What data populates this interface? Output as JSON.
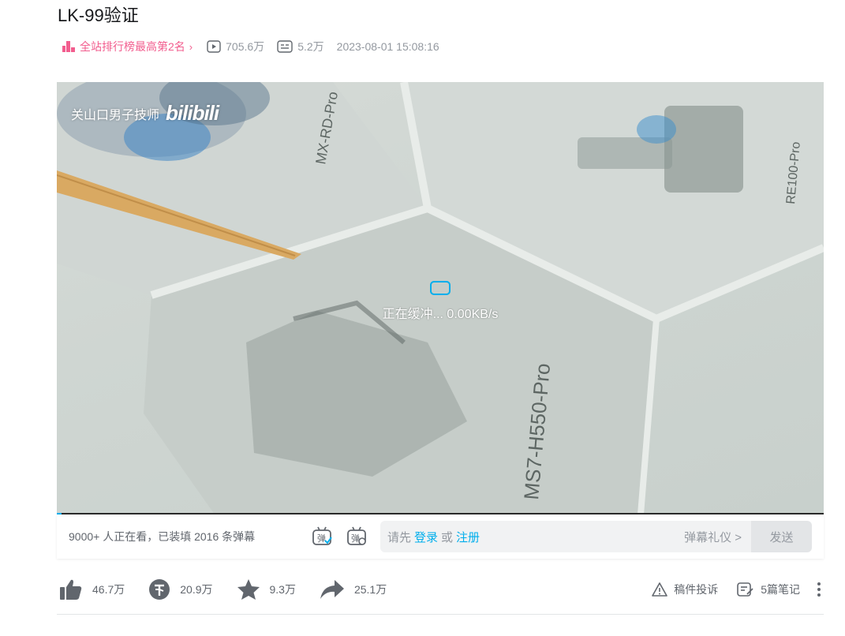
{
  "video": {
    "title": "LK-99验证",
    "rank_label": "全站排行榜最高第2名",
    "plays": "705.6万",
    "danmaku_count": "5.2万",
    "publish_time": "2023-08-01 15:08:16"
  },
  "player": {
    "watermark_author": "关山口男子技师",
    "watermark_logo": "bilibili",
    "buffer_text": "正在缓冲... 0.00KB/s",
    "scene_labels": [
      "MX-RD-Pro",
      "RE100-Pro",
      "MS7-H550-Pro"
    ],
    "progress_fraction": 0.006
  },
  "danmu_bar": {
    "viewers_text": "9000+ 人正在看，已装填 2016 条弹幕",
    "input_prefix": "请先",
    "login_link": "登录",
    "or_text": "或",
    "register_link": "注册",
    "etiquette": "弹幕礼仪 >",
    "send_label": "发送"
  },
  "toolbar": {
    "like": "46.7万",
    "coin": "20.9万",
    "favorite": "9.3万",
    "share": "25.1万",
    "report": "稿件投诉",
    "notes": "5篇笔记"
  },
  "colors": {
    "accent": "#00aeec",
    "rank_pink": "#f25d8e",
    "icon_gray": "#61666d"
  }
}
